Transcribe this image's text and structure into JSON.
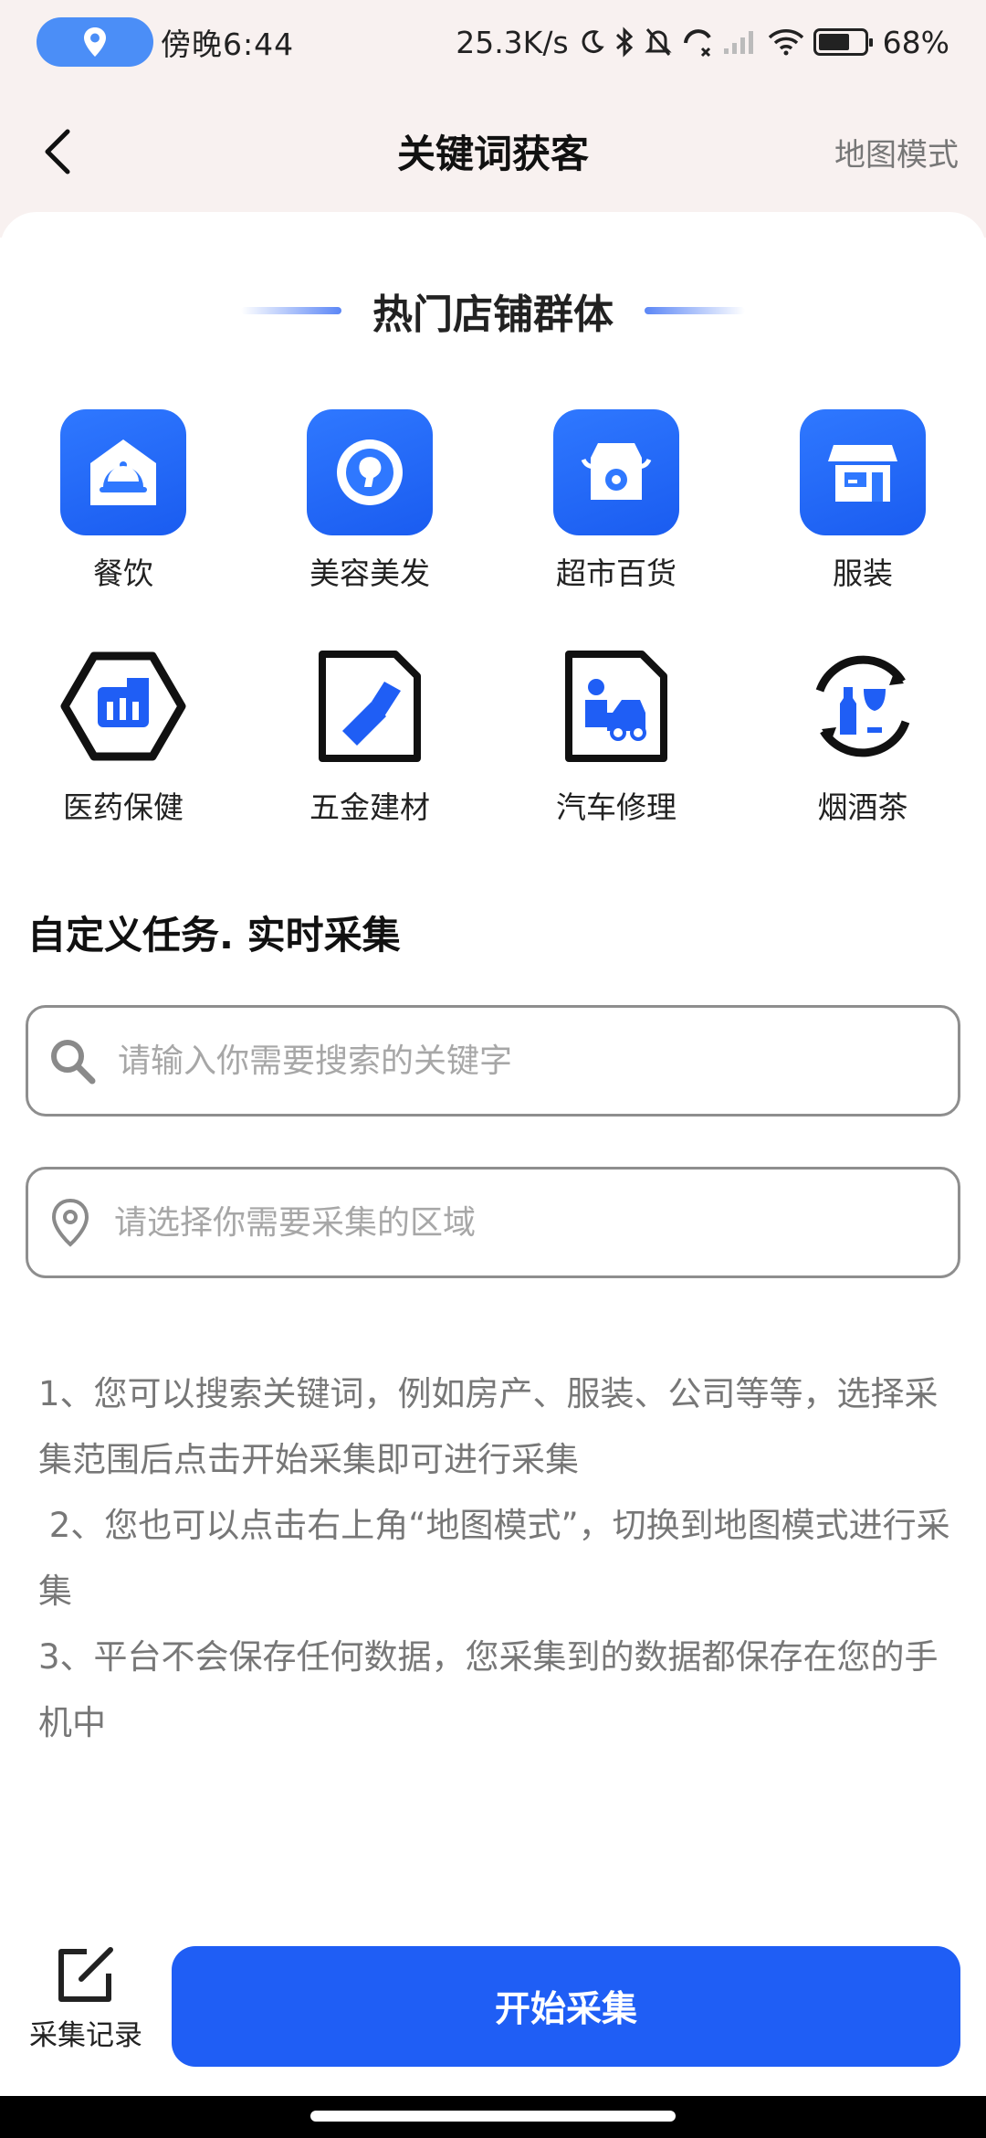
{
  "status_bar": {
    "time": "傍晚6:44",
    "net_speed": "25.3K/s",
    "battery": "68%",
    "icons": [
      "location-icon",
      "moon-icon",
      "bluetooth-icon",
      "bell-muted-icon",
      "call-icon",
      "signal-icon",
      "wifi-icon",
      "battery-icon"
    ]
  },
  "nav": {
    "title": "关键词获客",
    "right_action": "地图模式"
  },
  "hot": {
    "title": "热门店铺群体",
    "categories": [
      {
        "label": "餐饮",
        "icon": "dining-icon"
      },
      {
        "label": "美容美发",
        "icon": "beauty-icon"
      },
      {
        "label": "超市百货",
        "icon": "supermarket-icon"
      },
      {
        "label": "服装",
        "icon": "clothing-store-icon"
      },
      {
        "label": "医药保健",
        "icon": "medicine-icon"
      },
      {
        "label": "五金建材",
        "icon": "hardware-icon"
      },
      {
        "label": "汽车修理",
        "icon": "car-repair-icon"
      },
      {
        "label": "烟酒茶",
        "icon": "tobacco-wine-tea-icon"
      }
    ]
  },
  "custom": {
    "title": "自定义任务. 实时采集",
    "search_placeholder": "请输入你需要搜索的关键字",
    "area_placeholder": "请选择你需要采集的区域"
  },
  "instructions": [
    "1、您可以搜索关键词，例如房产、服装、公司等等，选择采集范围后点击开始采集即可进行采集",
    " 2、您也可以点击右上角“地图模式”，切换到地图模式进行采集",
    "3、平台不会保存任何数据，您采集到的数据都保存在您的手机中"
  ],
  "bottom": {
    "records_label": "采集记录",
    "start_label": "开始采集"
  },
  "colors": {
    "primary": "#1f5ef5",
    "top_background": "#f8f1f0",
    "hint_text": "#777777"
  }
}
